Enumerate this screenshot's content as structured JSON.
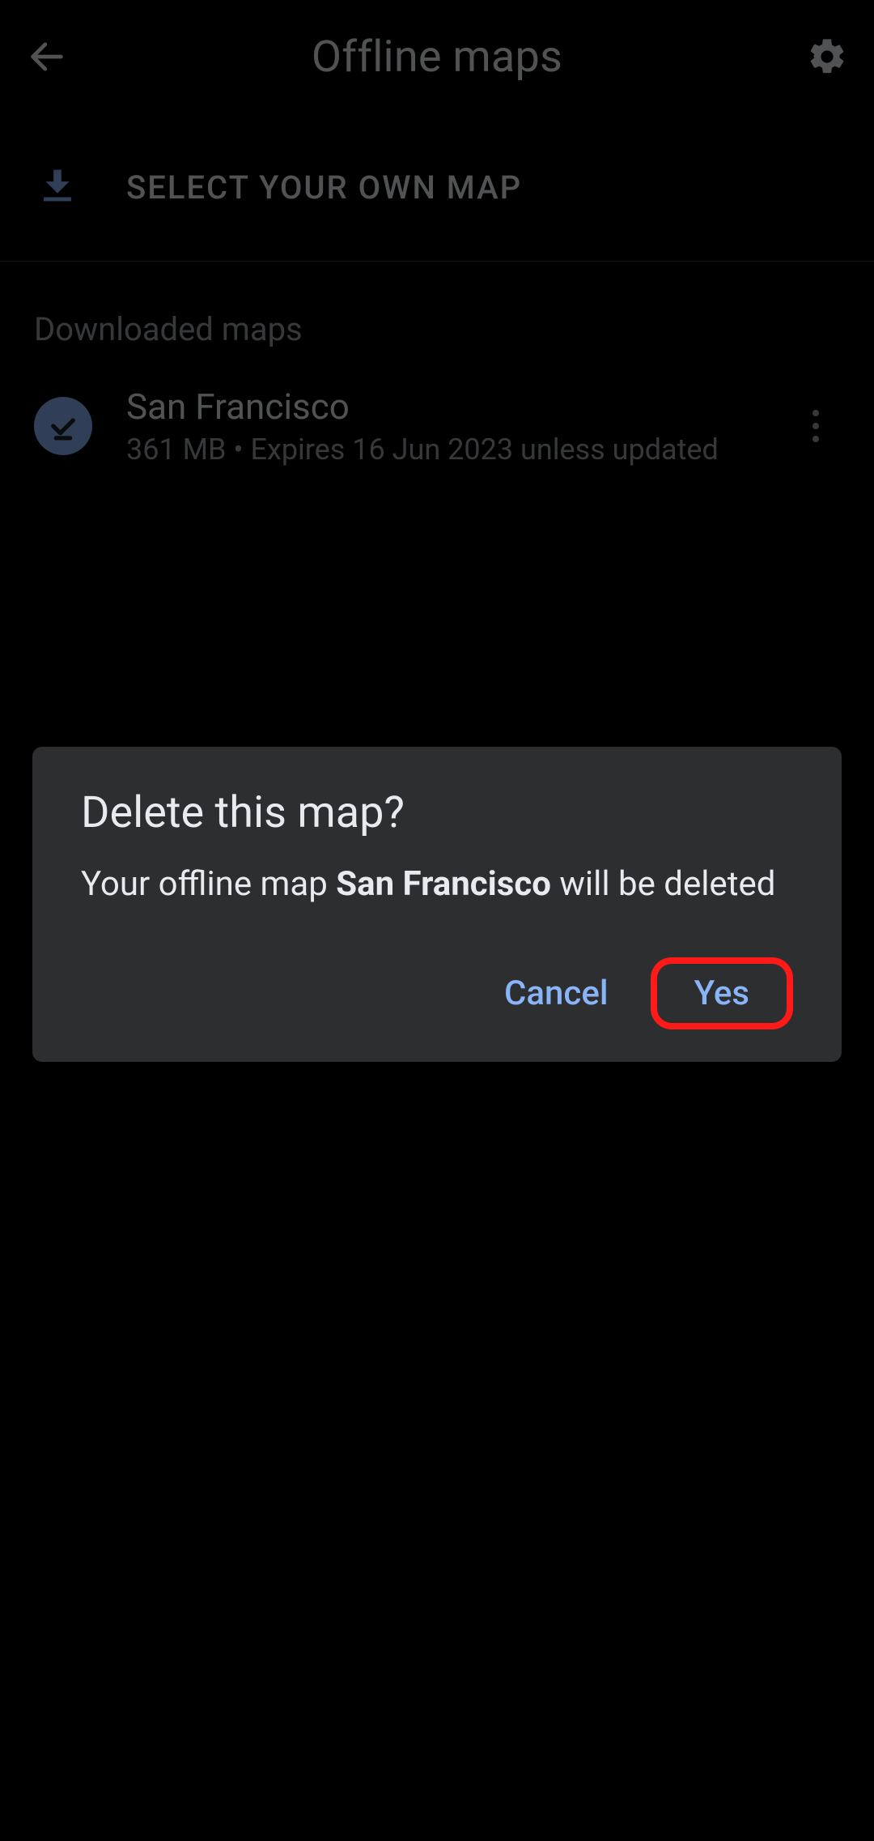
{
  "header": {
    "title": "Offline maps"
  },
  "select_row": {
    "label": "SELECT YOUR OWN MAP"
  },
  "downloaded": {
    "header": "Downloaded maps",
    "items": [
      {
        "name": "San Francisco",
        "subtitle": "361 MB • Expires 16 Jun 2023 unless updated"
      }
    ]
  },
  "dialog": {
    "title": "Delete this map?",
    "message_prefix": "Your offline map ",
    "message_map_name": "San Francisco",
    "message_suffix": " will be deleted",
    "cancel": "Cancel",
    "confirm": "Yes"
  }
}
